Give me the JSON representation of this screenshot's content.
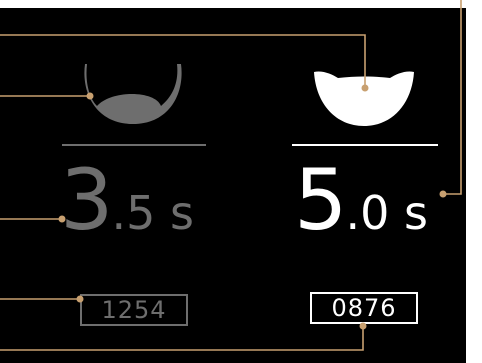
{
  "colors": {
    "background": "#000000",
    "inactive": "#6e6e6e",
    "active": "#ffffff",
    "callout": "#c8a070"
  },
  "left_panel": {
    "icon": "bowl-outline-icon",
    "state": "inactive",
    "time_major": "3",
    "time_minor": ".5 s",
    "counter": "1254"
  },
  "right_panel": {
    "icon": "bowl-filled-icon",
    "state": "active",
    "time_major": "5",
    "time_minor": ".0 s",
    "counter": "0876"
  }
}
